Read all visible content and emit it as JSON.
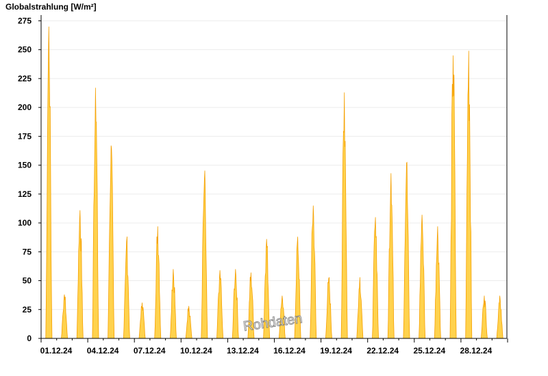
{
  "chart_data": {
    "type": "area",
    "ylabel": "Globalstrahlung [W/m²]",
    "ylim": [
      0,
      280
    ],
    "yticks": [
      0,
      25,
      50,
      75,
      100,
      125,
      150,
      175,
      200,
      225,
      250,
      275
    ],
    "xlim": [
      "01.12.24",
      "31.12.24"
    ],
    "xticks": [
      "01.12.24",
      "04.12.24",
      "07.12.24",
      "10.12.24",
      "13.12.24",
      "16.12.24",
      "19.12.24",
      "22.12.24",
      "25.12.24",
      "28.12.24"
    ],
    "grid": true,
    "fill_color": "#ffd24d",
    "line_color": "#f5a000",
    "series": [
      {
        "days": [
          "01.12.24",
          "02.12.24",
          "03.12.24",
          "04.12.24",
          "05.12.24",
          "06.12.24",
          "07.12.24",
          "08.12.24",
          "09.12.24",
          "10.12.24",
          "11.12.24",
          "12.12.24",
          "13.12.24",
          "14.12.24",
          "15.12.24",
          "16.12.24",
          "17.12.24",
          "18.12.24",
          "19.12.24",
          "20.12.24",
          "21.12.24",
          "22.12.24",
          "23.12.24",
          "24.12.24",
          "25.12.24",
          "26.12.24",
          "27.12.24",
          "28.12.24",
          "29.12.24",
          "30.12.24"
        ],
        "daily_peak": [
          270,
          38,
          111,
          217,
          167,
          84,
          31,
          97,
          60,
          28,
          138,
          59,
          60,
          57,
          86,
          37,
          88,
          115,
          52,
          213,
          53,
          105,
          143,
          152,
          107,
          97,
          245,
          249,
          37,
          37
        ]
      }
    ]
  },
  "watermark": {
    "text": "Rohdaten"
  }
}
